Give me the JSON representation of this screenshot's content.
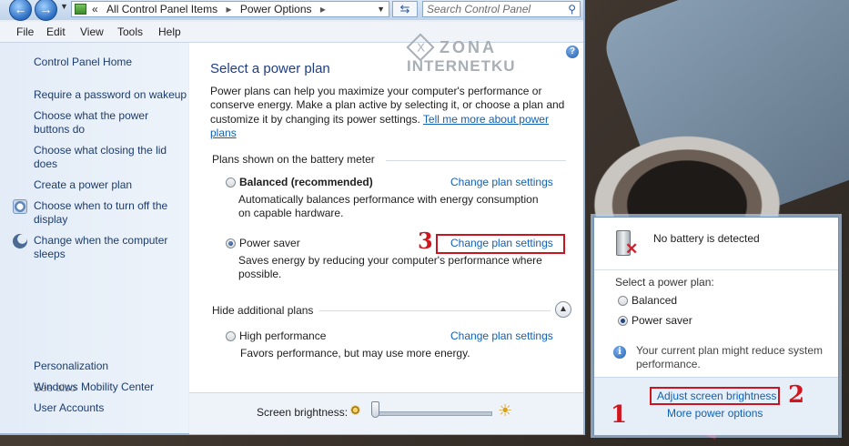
{
  "window": {
    "address": {
      "overflow": "«",
      "crumbs": [
        "All Control Panel Items",
        "Power Options"
      ]
    },
    "search": {
      "placeholder": "Search Control Panel"
    },
    "menu": [
      "File",
      "Edit",
      "View",
      "Tools",
      "Help"
    ]
  },
  "watermark": {
    "line1": "ZONA",
    "line2": "INTERNETKU"
  },
  "left_pane": {
    "home": "Control Panel Home",
    "tasks": [
      "Require a password on wakeup",
      "Choose what the power buttons do",
      "Choose what closing the lid does",
      "Create a power plan",
      "Choose when to turn off the display",
      "Change when the computer sleeps"
    ],
    "see_also_heading": "See also",
    "see_also": [
      "Personalization",
      "Windows Mobility Center",
      "User Accounts"
    ]
  },
  "content": {
    "title": "Select a power plan",
    "intro": "Power plans can help you maximize your computer's performance or conserve energy. Make a plan active by selecting it, or choose a plan and customize it by changing its power settings.",
    "intro_link": "Tell me more about power plans",
    "battery_meter_heading": "Plans shown on the battery meter",
    "plans": [
      {
        "name": "Balanced (recommended)",
        "desc": "Automatically balances performance with energy consumption on capable hardware.",
        "selected": false,
        "link": "Change plan settings"
      },
      {
        "name": "Power saver",
        "desc": "Saves energy by reducing your computer's performance where possible.",
        "selected": true,
        "link": "Change plan settings"
      }
    ],
    "additional_heading": "Hide additional plans",
    "additional_plans": [
      {
        "name": "High performance",
        "desc": "Favors performance, but may use more energy.",
        "selected": false,
        "link": "Change plan settings"
      }
    ],
    "brightness_label": "Screen brightness:",
    "brightness_level": 0.0
  },
  "flyout": {
    "status": "No battery is detected",
    "select_label": "Select a power plan:",
    "options": [
      {
        "name": "Balanced",
        "selected": false
      },
      {
        "name": "Power saver",
        "selected": true
      }
    ],
    "info": "Your current plan might reduce system performance.",
    "adjust_link": "Adjust screen brightness",
    "more_link": "More power options"
  },
  "callouts": {
    "one": "1",
    "two": "2",
    "three": "3"
  },
  "colors": {
    "link": "#0f61b5",
    "title": "#1e3e84",
    "highlight": "#c9151f"
  }
}
